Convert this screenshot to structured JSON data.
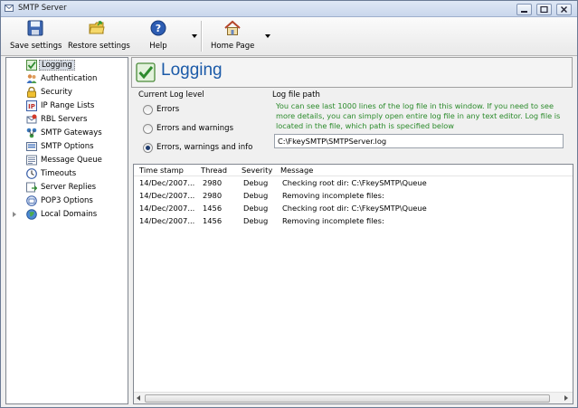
{
  "window": {
    "title": "SMTP Server"
  },
  "toolbar": {
    "save_label": "Save settings",
    "restore_label": "Restore settings",
    "help_label": "Help",
    "homepage_label": "Home Page"
  },
  "tree": {
    "items": [
      {
        "label": "Logging",
        "icon": "checkmark-icon"
      },
      {
        "label": "Authentication",
        "icon": "people-icon"
      },
      {
        "label": "Security",
        "icon": "lock-icon"
      },
      {
        "label": "IP Range Lists",
        "icon": "ip-list-icon"
      },
      {
        "label": "RBL Servers",
        "icon": "rbl-icon"
      },
      {
        "label": "SMTP Gateways",
        "icon": "gateway-icon"
      },
      {
        "label": "SMTP Options",
        "icon": "options-icon"
      },
      {
        "label": "Message Queue",
        "icon": "queue-icon"
      },
      {
        "label": "Timeouts",
        "icon": "clock-icon"
      },
      {
        "label": "Server Replies",
        "icon": "replies-icon"
      },
      {
        "label": "POP3 Options",
        "icon": "pop3-icon"
      },
      {
        "label": "Local Domains",
        "icon": "globe-icon"
      }
    ]
  },
  "main": {
    "title": "Logging",
    "log_level": {
      "label": "Current Log level",
      "options": [
        "Errors",
        "Errors and warnings",
        "Errors, warnings and  info"
      ],
      "selected": "Errors, warnings and  info"
    },
    "log_path": {
      "label": "Log file path",
      "info": "You can see last 1000 lines of the log file in this window. If you need to see more details, you can simply open entire log file in any text editor. Log file is located in the file, which path is specified below",
      "value": "C:\\FkeySMTP\\SMTPServer.log"
    },
    "table": {
      "columns": [
        "Time stamp",
        "Thread",
        "Severity",
        "Message"
      ],
      "rows": [
        [
          "14/Dec/2007...",
          "2980",
          "Debug",
          "Checking root dir: C:\\FkeySMTP\\Queue"
        ],
        [
          "14/Dec/2007...",
          "2980",
          "Debug",
          "Removing incomplete files:"
        ],
        [
          "14/Dec/2007...",
          "1456",
          "Debug",
          "Checking root dir: C:\\FkeySMTP\\Queue"
        ],
        [
          "14/Dec/2007...",
          "1456",
          "Debug",
          "Removing incomplete files:"
        ]
      ]
    }
  },
  "colors": {
    "accent": "#1b5aa8",
    "info_text": "#2a8a2a"
  }
}
